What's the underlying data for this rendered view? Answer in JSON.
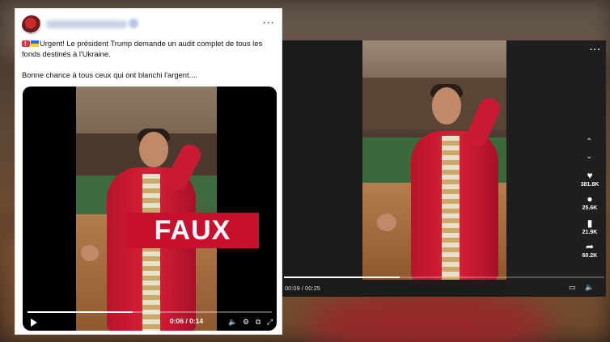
{
  "background": {
    "accent": "#c8102e"
  },
  "tweet": {
    "more_icon": "more-horizontal-icon",
    "text_line1": "Urgent! Le président Trump demande un audit complet de tous les fonds destinés à l'Ukraine.",
    "text_line2": "Bonne chance à tous ceux qui ont blanchi l'argent....",
    "overlay_label": "FAUX",
    "time": "0:06 / 0:14",
    "progress": 0.43
  },
  "video": {
    "actions": [
      {
        "icon": "heart-icon",
        "count": "381.8K"
      },
      {
        "icon": "comment-icon",
        "count": "25.6K"
      },
      {
        "icon": "bookmark-icon",
        "count": "21.9K"
      },
      {
        "icon": "share-icon",
        "count": "60.2K"
      }
    ],
    "time": "00:09 / 00:25",
    "progress": 0.36
  }
}
